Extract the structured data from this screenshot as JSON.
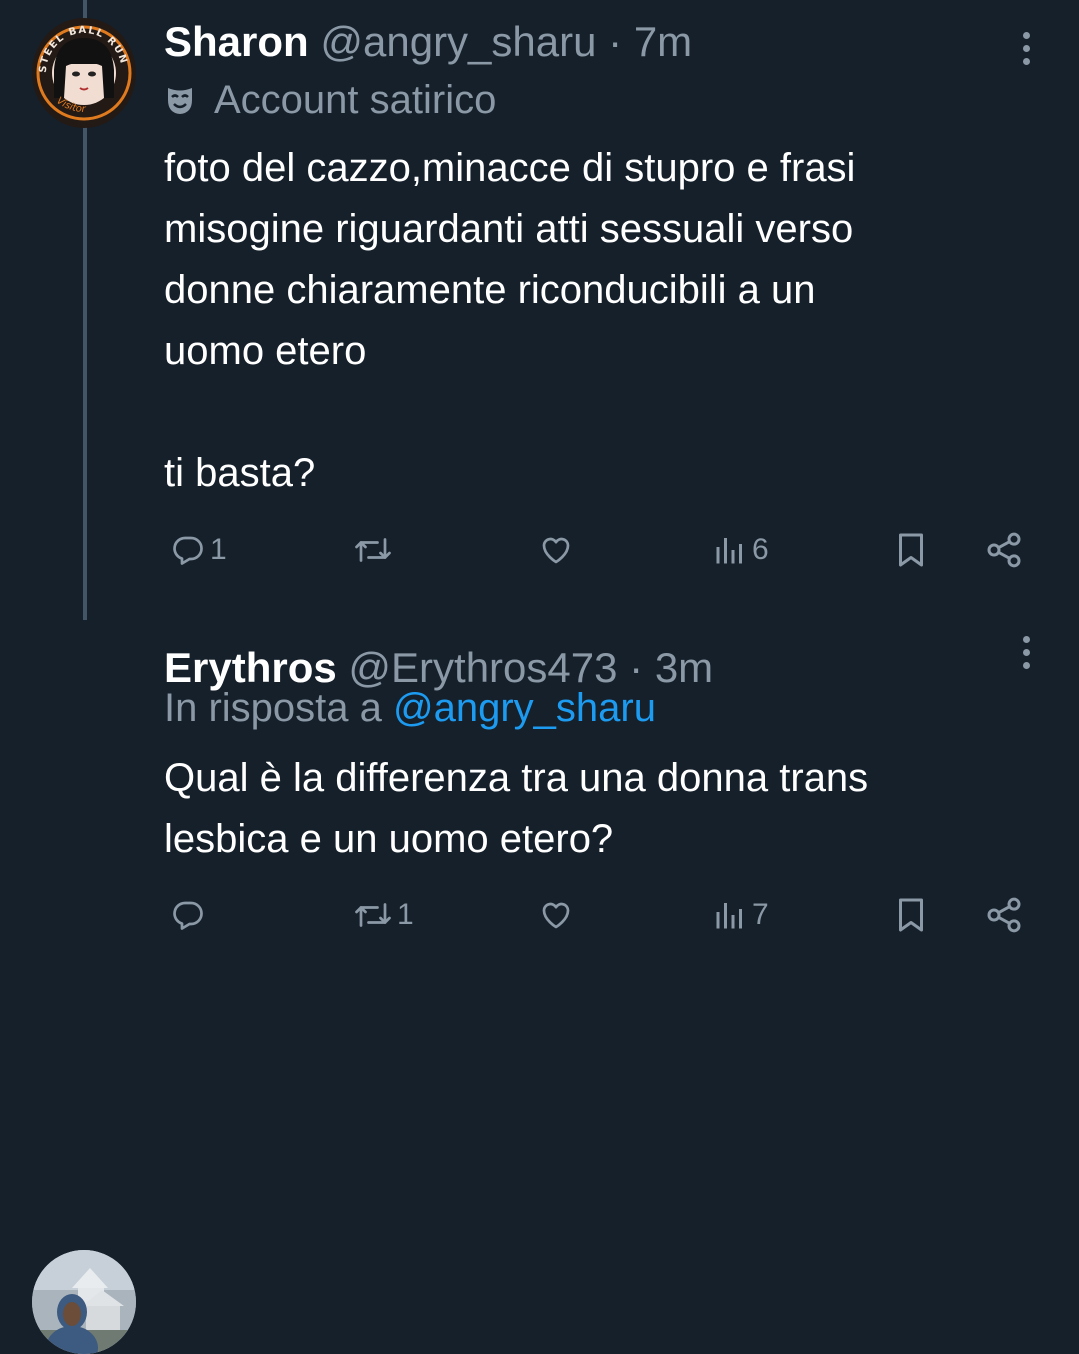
{
  "colors": {
    "background": "#15202b",
    "primary_text": "#ffffff",
    "secondary_text": "#8b98a5",
    "link": "#1d9bf0",
    "thread_line": "#425666"
  },
  "tweets": [
    {
      "name": "Sharon",
      "handle": "@angry_sharu",
      "separator": "·",
      "time": "7m",
      "label_icon": "theater-mask-icon",
      "label": "Account satirico",
      "avatar_text_top": "STEEL BALL RUN",
      "avatar_text_bottom": "Visitor",
      "text": "foto del cazzo,minacce di stupro e frasi\nmisogine riguardanti atti sessuali verso\ndonne chiaramente riconducibili a un\nuomo etero\n\nti basta?",
      "stats": {
        "replies": "1",
        "reposts": "",
        "likes": "",
        "views": "6"
      }
    },
    {
      "name": "Erythros",
      "handle": "@Erythros473",
      "separator": "·",
      "time": "3m",
      "reply_prefix": "In risposta a",
      "reply_to": "@angry_sharu",
      "text": "Qual è la differenza tra una donna trans\nlesbica e un uomo etero?",
      "stats": {
        "replies": "",
        "reposts": "1",
        "likes": "",
        "views": "7"
      }
    }
  ]
}
